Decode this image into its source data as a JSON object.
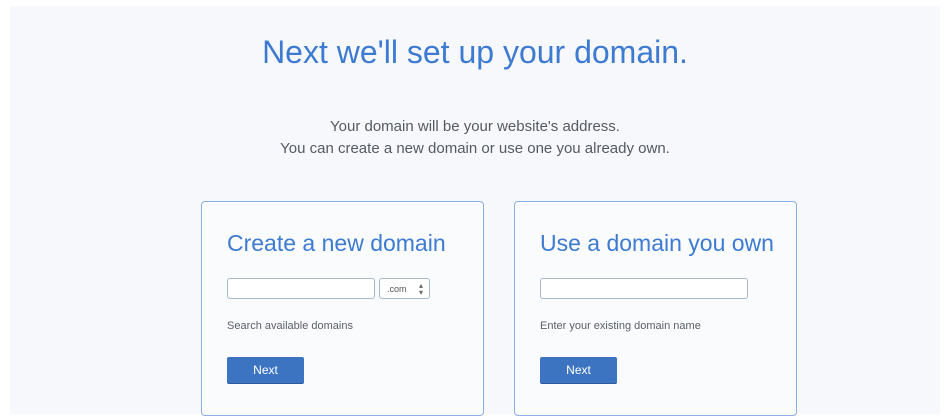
{
  "header": {
    "title": "Next we'll set up your domain.",
    "subtitle_line1": "Your domain will be your website's address.",
    "subtitle_line2": "You can create a new domain or use one you already own."
  },
  "new_domain": {
    "title": "Create a new domain",
    "input_value": "",
    "tld_selected": ".com",
    "hint": "Search available domains",
    "button_label": "Next"
  },
  "existing_domain": {
    "title": "Use a domain you own",
    "input_value": "",
    "hint": "Enter your existing domain name",
    "button_label": "Next"
  },
  "colors": {
    "accent": "#3d7ad1",
    "button": "#3d74c2",
    "card_border": "#8cb0e3"
  }
}
